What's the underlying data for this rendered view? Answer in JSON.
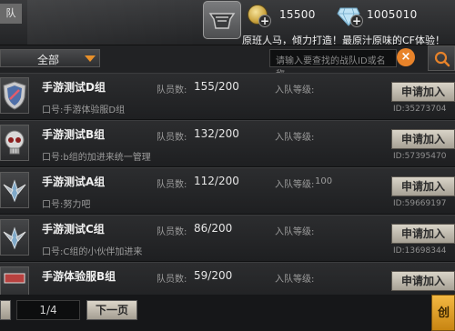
{
  "topbar": {
    "tab_label": "队",
    "gold_amount": "15500",
    "diamond_amount": "1005010",
    "marquee": "原班人马，倾力打造！最原汁原味的CF体验！"
  },
  "filter": {
    "dropdown_value": "全部",
    "search_placeholder": "请输入要查找的战队ID或名称"
  },
  "list": {
    "members_label": "队员数:",
    "level_label": "入队等级:",
    "apply_label": "申请加入",
    "rows": [
      {
        "name": "手游测试D组",
        "motto": "口号:手游体验服D组",
        "members": "155/200",
        "level": "",
        "id": "ID:35273704"
      },
      {
        "name": "手游测试B组",
        "motto": "口号:b组的加进来统一管理",
        "members": "132/200",
        "level": "",
        "id": "ID:57395470"
      },
      {
        "name": "手游测试A组",
        "motto": "口号:努力吧",
        "members": "112/200",
        "level": "100",
        "id": "ID:59669197"
      },
      {
        "name": "手游测试C组",
        "motto": "口号:C组的小伙伴加进来",
        "members": "86/200",
        "level": "",
        "id": "ID:13698344"
      },
      {
        "name": "手游体验服B组",
        "motto": "",
        "members": "59/200",
        "level": "",
        "id": ""
      }
    ]
  },
  "pager": {
    "page": "1/4",
    "next_label": "下一页",
    "create_label": "创"
  },
  "colors": {
    "accent": "#e8832a",
    "gold": "#c9a23d",
    "button_bg": "#d9d4c8"
  }
}
